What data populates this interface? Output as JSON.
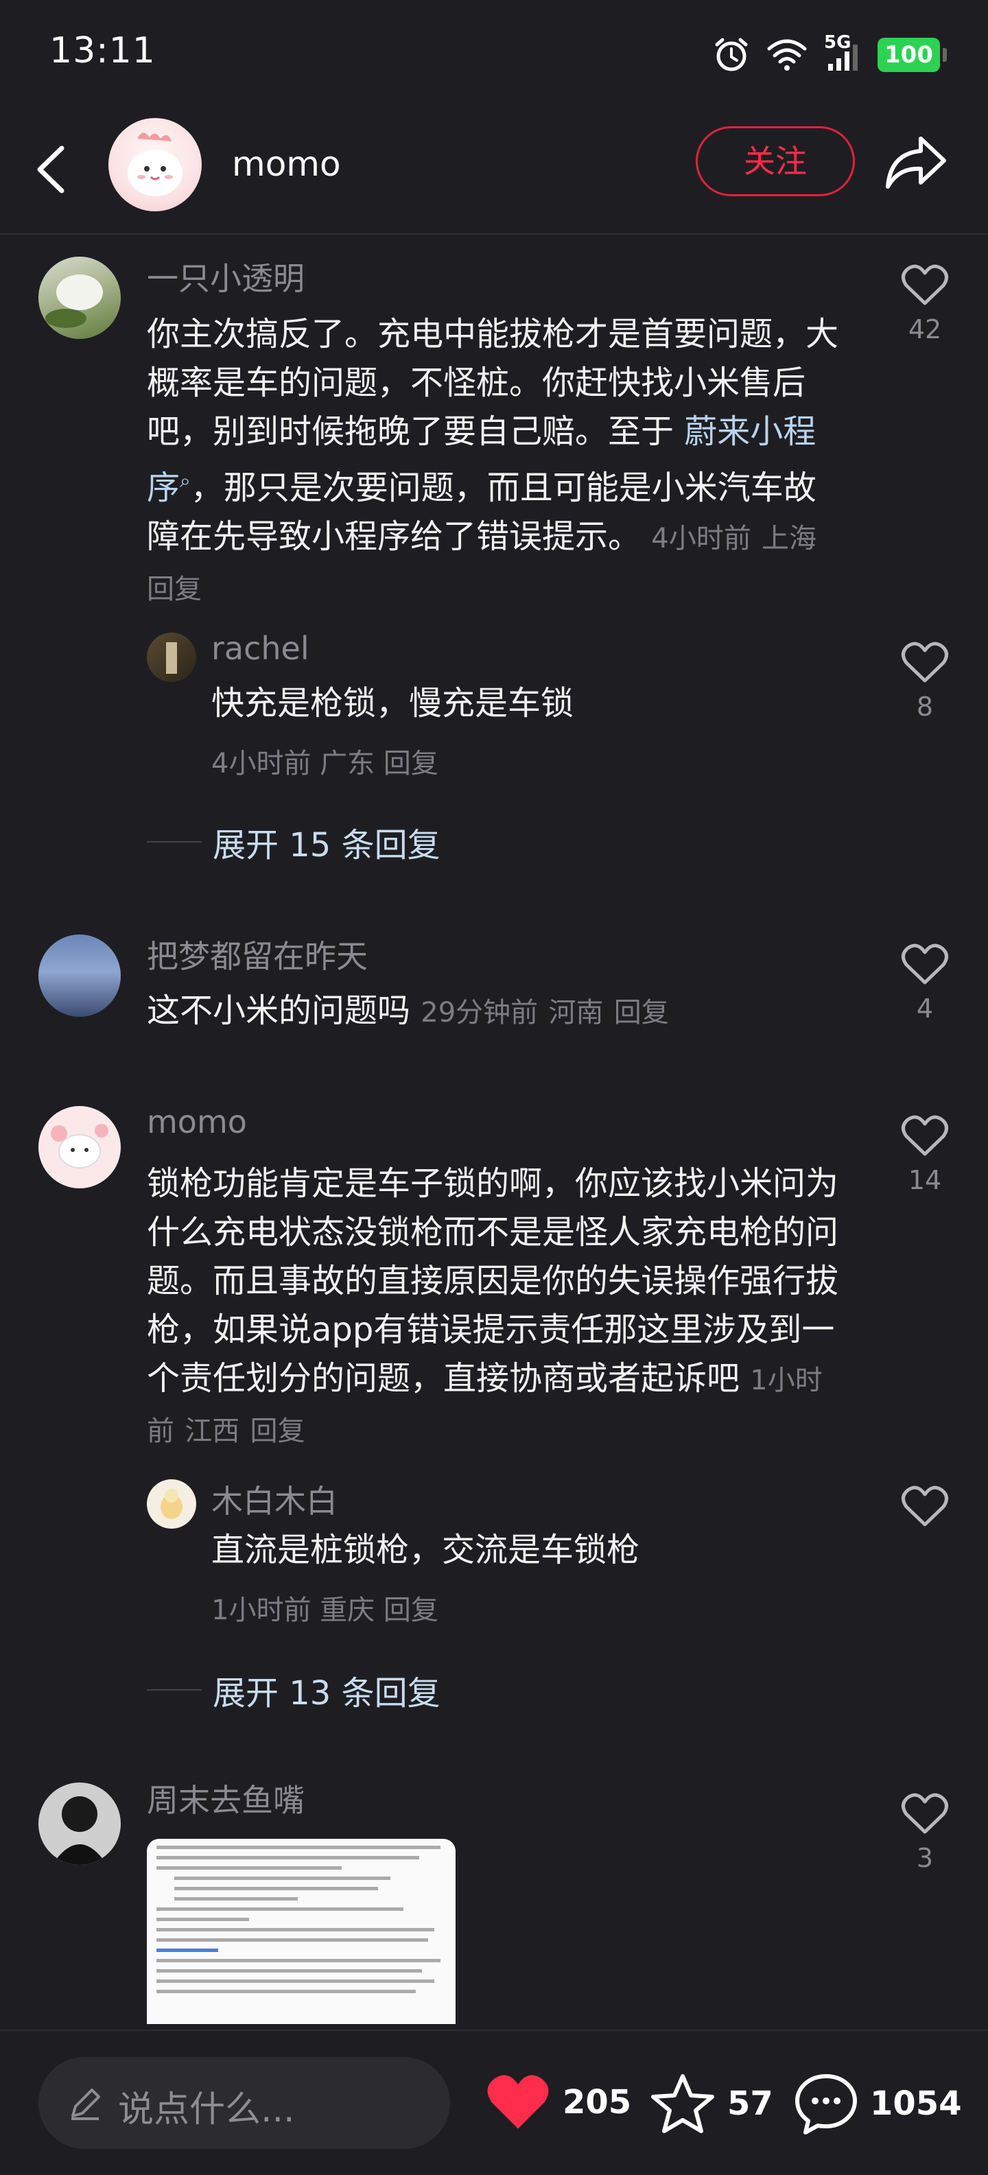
{
  "status": {
    "time": "13:11",
    "network": "5G",
    "battery": "100"
  },
  "header": {
    "name": "momo",
    "follow": "关注"
  },
  "comments": [
    {
      "name": "一只小透明",
      "text_before_link": "你主次搞反了。充电中能拔枪才是首要问题，大概率是车的问题，不怪桩。你赶快找小米售后吧，别到时候拖晚了要自己赔。至于",
      "link": "蔚来小程序",
      "text_after_link": "，那只是次要问题，而且可能是小米汽车故障在先导致小程序给了错误提示。",
      "time": "4小时前",
      "region": "上海",
      "reply": "回复",
      "likes": "42"
    },
    {
      "name": "rachel",
      "text": "快充是枪锁，慢充是车锁",
      "time": "4小时前",
      "region": "广东",
      "reply": "回复",
      "likes": "8"
    },
    {
      "name": "把梦都留在昨天",
      "text": "这不小米的问题吗",
      "time": "29分钟前",
      "region": "河南",
      "reply": "回复",
      "likes": "4"
    },
    {
      "name": "momo",
      "text": "锁枪功能肯定是车子锁的啊，你应该找小米问为什么充电状态没锁枪而不是是怪人家充电枪的问题。而且事故的直接原因是你的失误操作强行拔枪，如果说app有错误提示责任那这里涉及到一个责任划分的问题，直接协商或者起诉吧",
      "time": "1小时前",
      "region": "江西",
      "reply": "回复",
      "likes": "14"
    },
    {
      "name": "木白木白",
      "text": "直流是桩锁枪，交流是车锁枪",
      "time": "1小时前",
      "region": "重庆",
      "reply": "回复",
      "likes": ""
    },
    {
      "name": "周末去鱼嘴",
      "likes": "3"
    }
  ],
  "expand": [
    "展开 15 条回复",
    "展开 13 条回复"
  ],
  "bottom": {
    "placeholder": "说点什么...",
    "likes": "205",
    "stars": "57",
    "comments": "1054"
  },
  "colors": {
    "accent": "#ff2d4c",
    "like_red": "#ff2d4c",
    "background": "#1e1e22"
  },
  "icons": [
    "back-icon",
    "share-icon",
    "heart-icon",
    "star-icon",
    "comment-icon",
    "pencil-icon",
    "alarm-icon",
    "wifi-icon",
    "signal-icon"
  ]
}
